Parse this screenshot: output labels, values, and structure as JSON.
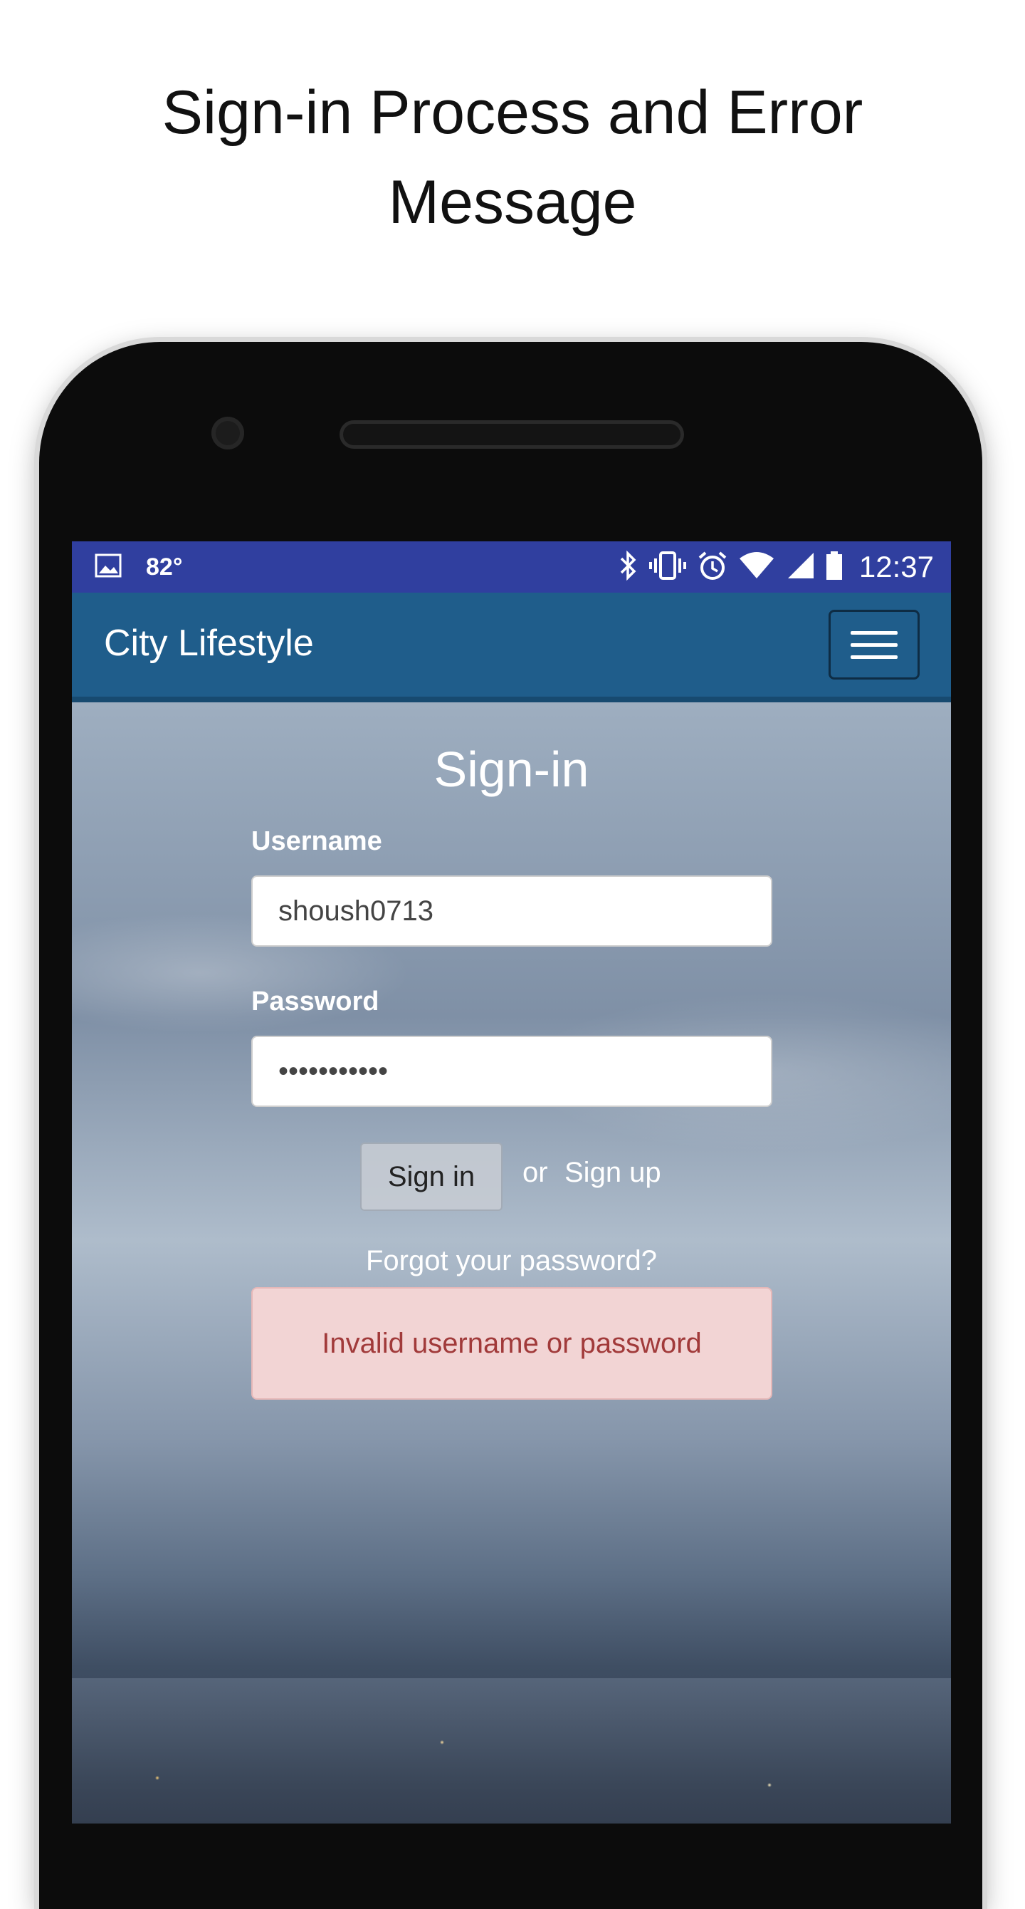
{
  "promo": {
    "title": "Sign-in Process and Error\nMessage"
  },
  "status_bar": {
    "temperature": "82°",
    "time": "12:37",
    "icons": [
      "image-icon",
      "bluetooth-icon",
      "vibrate-icon",
      "alarm-icon",
      "wifi-icon",
      "signal-icon",
      "battery-icon"
    ]
  },
  "navbar": {
    "brand": "City Lifestyle",
    "menu_icon": "hamburger-menu-icon"
  },
  "signin": {
    "title": "Sign-in",
    "username_label": "Username",
    "username_value": "shoush0713",
    "password_label": "Password",
    "password_value": "•••••••••••",
    "signin_button": "Sign in",
    "or_text": "or",
    "signup_link": "Sign up",
    "forgot_link": "Forgot your password?",
    "error_message": "Invalid username or password"
  },
  "colors": {
    "status_bar": "#303f9f",
    "navbar": "#1f5d8b",
    "error_bg": "#f2d4d4",
    "error_text": "#a13a3a"
  }
}
